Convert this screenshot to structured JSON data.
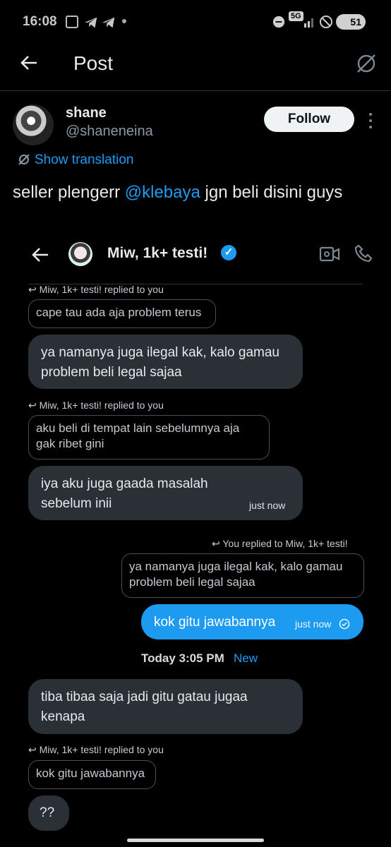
{
  "status_bar": {
    "time": "16:08",
    "battery": "51",
    "network": "5G"
  },
  "post_header": {
    "title": "Post"
  },
  "post": {
    "author_name": "shane",
    "author_handle": "@shaneneina",
    "follow_label": "Follow",
    "translation_label": "Show translation",
    "text_before": "seller plengerr ",
    "mention": "@klebaya",
    "text_after": " jgn beli disini guys"
  },
  "dm": {
    "contact_name": "Miw, 1k+ testi!",
    "items": {
      "reply1_hint": "Miw, 1k+ testi! replied to you",
      "reply1_quote": "cape tau ada aja problem terus",
      "msg1": "ya namanya juga ilegal kak, kalo gamau problem beli legal sajaa",
      "reply2_hint": "Miw, 1k+ testi! replied to you",
      "reply2_quote": "aku beli di tempat lain sebelumnya aja gak ribet gini",
      "msg2": "iya aku juga gaada masalah sebelum inii",
      "msg2_time": "just now",
      "you_reply_hint": "You replied to Miw, 1k+ testi!",
      "you_reply_quote": "ya namanya juga ilegal kak, kalo gamau problem beli legal sajaa",
      "sent_msg": "kok gitu jawabannya",
      "sent_time": "just now",
      "day_label": "Today 3:05 PM",
      "new_label": "New",
      "msg3": "tiba tibaa saja jadi gitu gatau jugaa kenapa",
      "reply3_hint": "Miw, 1k+ testi! replied to you",
      "reply3_quote": "kok gitu jawabannya",
      "msg4": "??"
    }
  },
  "colors": {
    "accent": "#1d9bf0",
    "background": "#000000",
    "bubble": "#2a3036"
  }
}
